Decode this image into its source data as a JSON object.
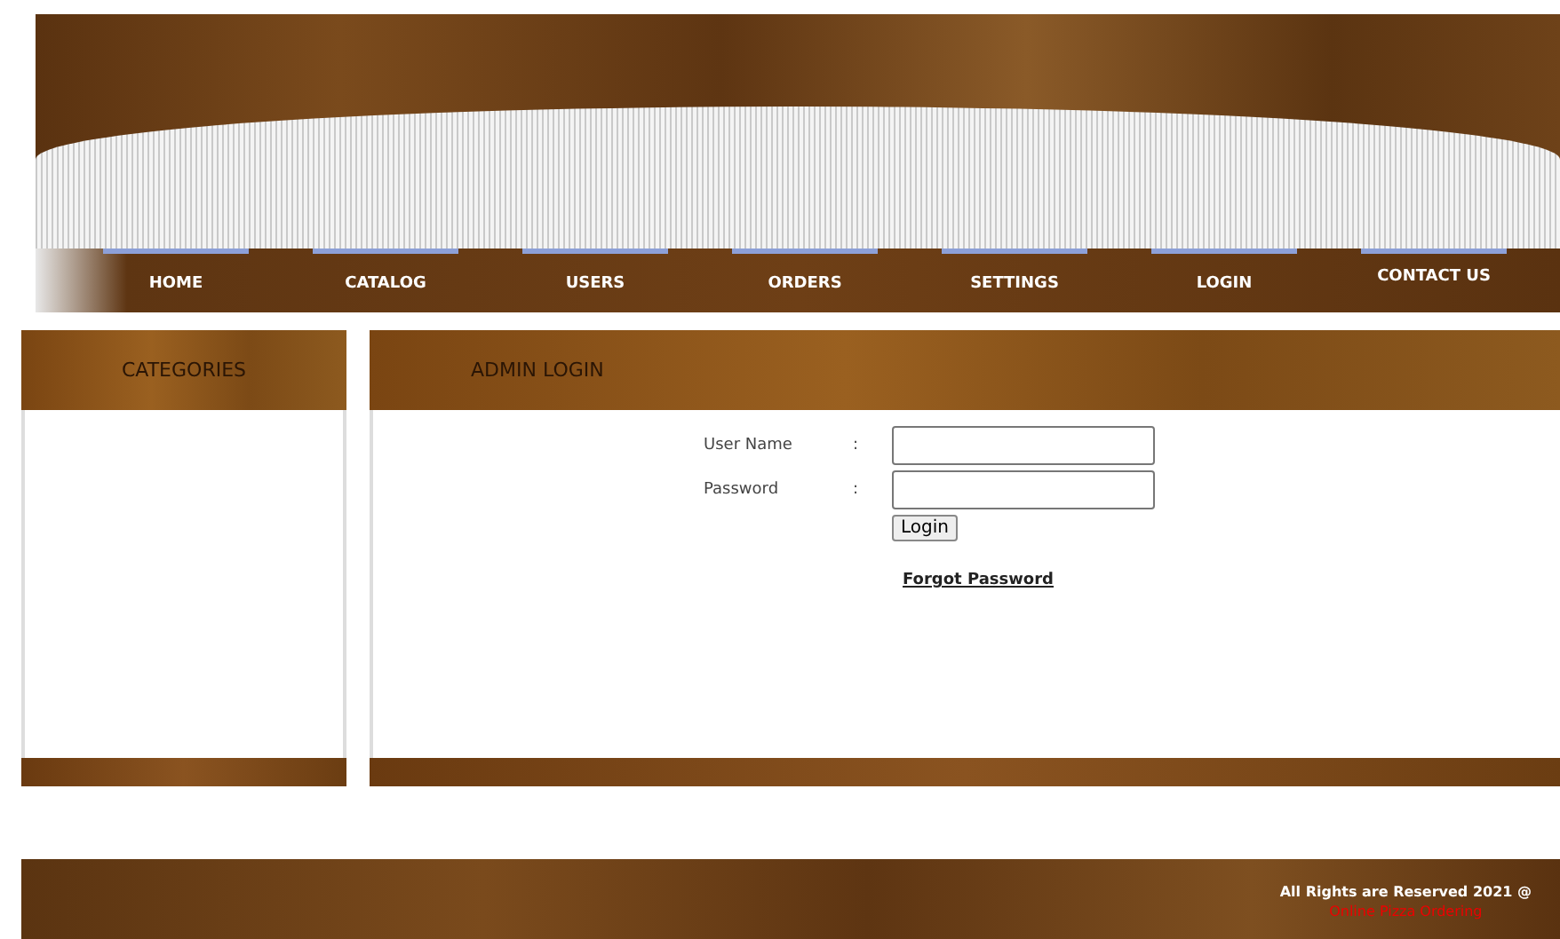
{
  "nav": [
    "HOME",
    "CATALOG",
    "USERS",
    "ORDERS",
    "SETTINGS",
    "LOGIN",
    "CONTACT US"
  ],
  "sidebar": {
    "title": "CATEGORIES"
  },
  "login": {
    "title": "ADMIN LOGIN",
    "fields": [
      {
        "label": "User Name",
        "separator": ":"
      },
      {
        "label": "Password",
        "separator": ":"
      }
    ],
    "button": "Login",
    "forgot": "Forgot Password"
  },
  "footer": {
    "rights": "All Rights are Reserved 2021 @",
    "site": "Online Pizza Ordering"
  }
}
